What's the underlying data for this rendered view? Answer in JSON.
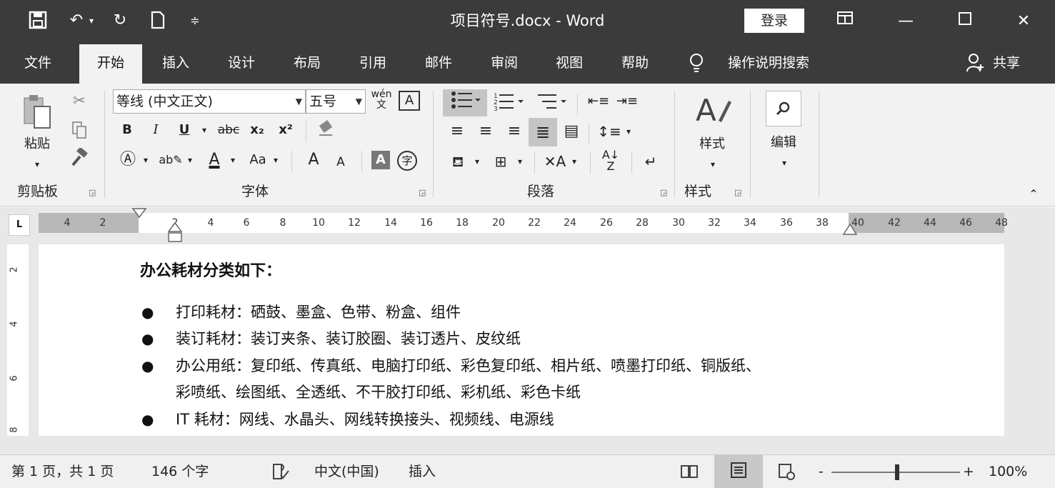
{
  "window": {
    "title": "项目符号.docx  -  Word",
    "login_label": "登录",
    "qat": {
      "save_icon": "floppy-disk-icon",
      "undo_icon": "undo-icon",
      "redo_icon": "redo-icon",
      "new_icon": "new-document-icon",
      "customize_icon": "customize-qat-icon"
    }
  },
  "tabs": [
    "文件",
    "开始",
    "插入",
    "设计",
    "布局",
    "引用",
    "邮件",
    "审阅",
    "视图",
    "帮助"
  ],
  "active_tab": "开始",
  "tell_me": "操作说明搜索",
  "share": "共享",
  "ribbon": {
    "clipboard": {
      "paste_label": "粘贴",
      "group_label": "剪贴板"
    },
    "font": {
      "font_name": "等线 (中文正文)",
      "font_size": "五号",
      "group_label": "字体",
      "bold": "B",
      "italic": "I",
      "underline": "U",
      "strikethrough": "abc",
      "subscript": "x₂",
      "superscript": "x²",
      "change_case": "Aa",
      "grow": "A",
      "shrink": "A",
      "font_color": "A",
      "phonetic": "wén\n文",
      "char_border": "A",
      "char_shade": "A",
      "enclose": "字"
    },
    "paragraph": {
      "group_label": "段落"
    },
    "styles": {
      "label": "样式",
      "group_label": "样式"
    },
    "editing": {
      "label": "编辑"
    }
  },
  "ruler": {
    "ticks": [
      "4",
      "2",
      "2",
      "4",
      "6",
      "8",
      "10",
      "12",
      "14",
      "16",
      "18",
      "20",
      "22",
      "24",
      "26",
      "28",
      "30",
      "32",
      "34",
      "36",
      "38",
      "40",
      "42",
      "44",
      "46",
      "48"
    ],
    "corner": "L"
  },
  "vruler": {
    "ticks": [
      "2",
      "4",
      "6",
      "8"
    ]
  },
  "document": {
    "heading": "办公耗材分类如下：",
    "bullet_char": "●",
    "lines": [
      "打印耗材：硒鼓、墨盒、色带、粉盒、组件",
      "装订耗材：装订夹条、装订胶圈、装订透片、皮纹纸",
      "办公用纸：复印纸、传真纸、电脑打印纸、彩色复印纸、相片纸、喷墨打印纸、铜版纸、",
      "彩喷纸、绘图纸、全透纸、不干胶打印纸、彩机纸、彩色卡纸",
      "IT 耗材：网线、水晶头、网线转换接头、视频线、电源线"
    ]
  },
  "status": {
    "page": "第 1 页，共 1 页",
    "words": "146 个字",
    "language": "中文(中国)",
    "mode": "插入",
    "zoom_minus": "-",
    "zoom_plus": "+",
    "zoom": "100%",
    "zoom_level": 1.0
  }
}
